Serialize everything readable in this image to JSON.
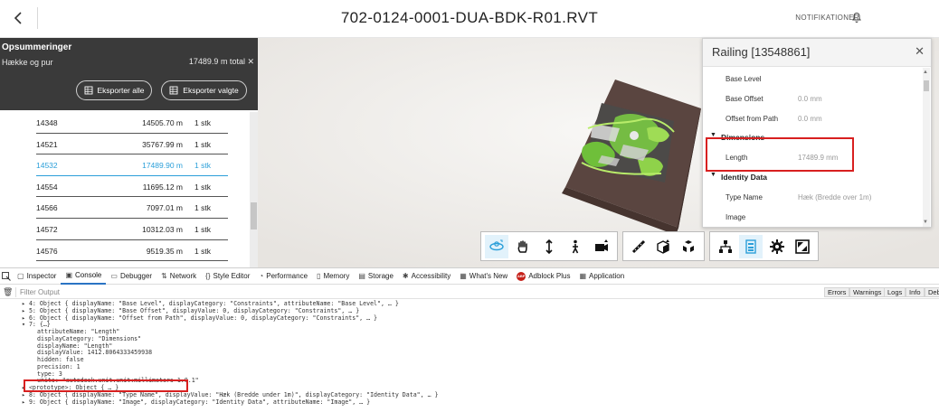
{
  "header": {
    "title": "702-0124-0001-DUA-BDK-R01.RVT",
    "notifications_label": "NOTIFIKATIONER"
  },
  "summary": {
    "title": "Opsummeringer",
    "subtitle": "Hække og pur",
    "total": "17489.9 m total ✕",
    "export_all": "Eksporter alle",
    "export_selected": "Eksporter valgte"
  },
  "list": {
    "rows": [
      {
        "id": "14348",
        "length": "14505.70 m",
        "count": "1 stk",
        "active": false
      },
      {
        "id": "14521",
        "length": "35767.99 m",
        "count": "1 stk",
        "active": false
      },
      {
        "id": "14532",
        "length": "17489.90 m",
        "count": "1 stk",
        "active": true
      },
      {
        "id": "14554",
        "length": "11695.12 m",
        "count": "1 stk",
        "active": false
      },
      {
        "id": "14566",
        "length": "7097.01 m",
        "count": "1 stk",
        "active": false
      },
      {
        "id": "14572",
        "length": "10312.03 m",
        "count": "1 stk",
        "active": false
      },
      {
        "id": "14576",
        "length": "9519.35 m",
        "count": "1 stk",
        "active": false
      }
    ]
  },
  "properties": {
    "title": "Railing [13548861]",
    "rows": [
      {
        "kind": "prop",
        "key": "Base Level",
        "value": ""
      },
      {
        "kind": "prop",
        "key": "Base Offset",
        "value": "0.0 mm"
      },
      {
        "kind": "prop",
        "key": "Offset from Path",
        "value": "0.0 mm"
      },
      {
        "kind": "cat",
        "key": "Dimensions"
      },
      {
        "kind": "prop",
        "key": "Length",
        "value": "17489.9 mm"
      },
      {
        "kind": "cat",
        "key": "Identity Data"
      },
      {
        "kind": "prop",
        "key": "Type Name",
        "value": "Hæk (Bredde over 1m)"
      },
      {
        "kind": "prop",
        "key": "Image",
        "value": ""
      }
    ]
  },
  "toolbar": {
    "tools": [
      "orbit-icon",
      "pan-icon",
      "zoom-icon",
      "walk-icon",
      "camera-icon",
      "measure-icon",
      "section-icon",
      "explode-icon",
      "model-browser-icon",
      "properties-icon",
      "settings-icon",
      "fullscreen-icon"
    ]
  },
  "devtools": {
    "tabs": [
      "Inspector",
      "Console",
      "Debugger",
      "Network",
      "Style Editor",
      "Performance",
      "Memory",
      "Storage",
      "Accessibility",
      "What's New",
      "Adblock Plus",
      "Application"
    ],
    "active_tab": "Console",
    "filter_placeholder": "Filter Output",
    "filters": [
      "Errors",
      "Warnings",
      "Logs",
      "Info",
      "Debu"
    ]
  },
  "console": {
    "lines": [
      "▸ 4: Object { displayName: \"Base Level\", displayCategory: \"Constraints\", attributeName: \"Base Level\", … }",
      "▸ 5: Object { displayName: \"Base Offset\", displayValue: 0, displayCategory: \"Constraints\", … }",
      "▸ 6: Object { displayName: \"Offset from Path\", displayValue: 0, displayCategory: \"Constraints\", … }",
      "▾ 7: {…}",
      "attributeName: \"Length\"",
      "displayCategory: \"Dimensions\"",
      "displayName: \"Length\"",
      "displayValue: 1412.8064333459938",
      "hidden: false",
      "precision: 1",
      "type: 3",
      "units: \"autodesk.unit.unit:millimeters-1.0.1\"",
      "▸ <prototype>: Object { … }",
      "▸ 8: Object { displayName: \"Type Name\", displayValue: \"Hæk (Bredde under 1m)\", displayCategory: \"Identity Data\", … }",
      "▸ 9: Object { displayName: \"Image\", displayCategory: \"Identity Data\", attributeName: \"Image\", … }"
    ]
  },
  "colors": {
    "accent": "#2b9fd9",
    "summary_bg": "#3a3a3a",
    "highlight": "#d82020",
    "viewport_bg": "#f1efec"
  }
}
